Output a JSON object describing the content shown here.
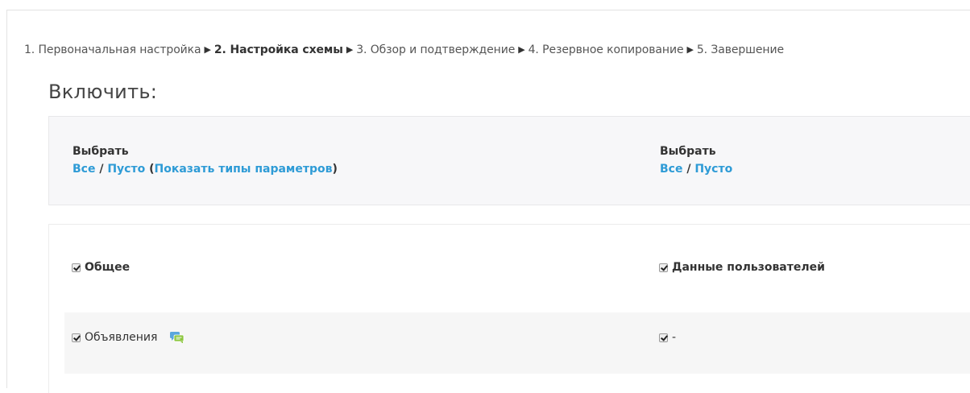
{
  "progress": {
    "steps": [
      {
        "label": "1. Первоначальная настройка",
        "current": false
      },
      {
        "label": "2. Настройка схемы",
        "current": true
      },
      {
        "label": "3. Обзор и подтверждение",
        "current": false
      },
      {
        "label": "4. Резервное копирование",
        "current": false
      },
      {
        "label": "5. Завершение",
        "current": false
      }
    ],
    "separator": "▶"
  },
  "section": {
    "title": "Включить:"
  },
  "select_left": {
    "heading": "Выбрать",
    "all_label": "Все",
    "slash": " / ",
    "none_label": "Пусто",
    "paren_open": " (",
    "show_types_label": "Показать типы параметров",
    "paren_close": ")"
  },
  "select_right": {
    "heading": "Выбрать",
    "all_label": "Все",
    "slash": " / ",
    "none_label": "Пусто"
  },
  "settings": {
    "general_label": "Общее",
    "user_data_label": "Данные пользователей",
    "announcements_label": "Объявления",
    "announcements_userdata_label": "-"
  },
  "colors": {
    "link": "#2e9bd6",
    "panel_bg": "#f7f7f9",
    "row_bg": "#f6f6f6"
  },
  "icons": {
    "forum_icon": "chat-bubbles-icon"
  }
}
